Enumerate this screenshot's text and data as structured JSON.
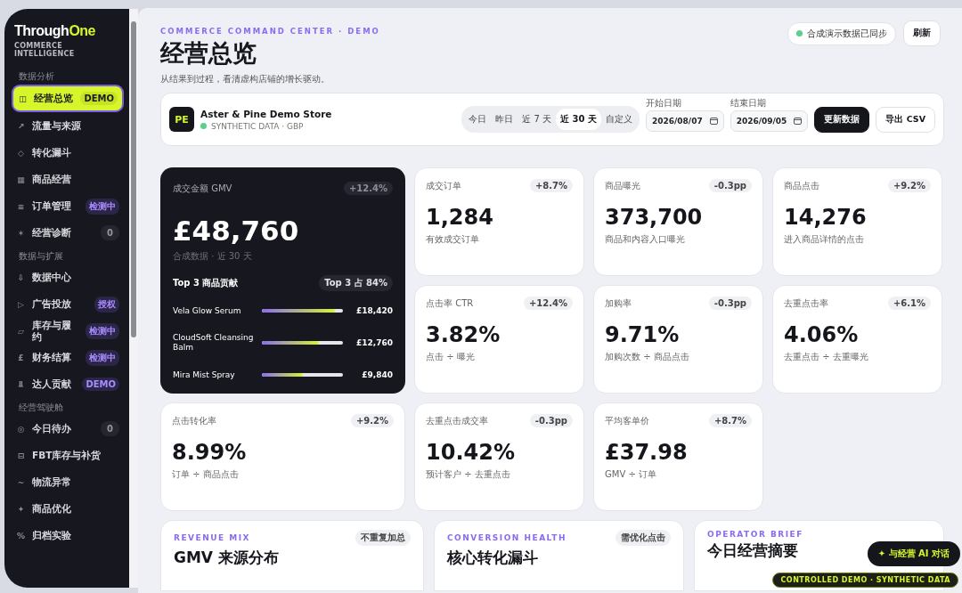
{
  "brand": {
    "name_a": "Through",
    "name_b": "One",
    "tagline": "COMMERCE INTELLIGENCE"
  },
  "sidebar": {
    "sections": [
      {
        "title": "数据分析",
        "items": [
          {
            "icon": "◫",
            "label": "经营总览",
            "badge": {
              "text": "DEMO",
              "kind": "demo"
            },
            "selected": true
          },
          {
            "icon": "↗",
            "label": "流量与来源",
            "selected": false
          },
          {
            "icon": "◇",
            "label": "转化漏斗",
            "selected": false
          },
          {
            "icon": "▦",
            "label": "商品经营",
            "selected": false
          },
          {
            "icon": "≡",
            "label": "订单管理",
            "badge": {
              "text": "检测中",
              "kind": "tag"
            },
            "selected": false
          },
          {
            "icon": "✶",
            "label": "经营诊断",
            "badge": {
              "text": "0",
              "kind": "count"
            },
            "selected": false
          }
        ]
      },
      {
        "title": "数据与扩展",
        "items": [
          {
            "icon": "⇩",
            "label": "数据中心",
            "selected": false
          },
          {
            "icon": "▷",
            "label": "广告投放",
            "badge": {
              "text": "授权",
              "kind": "tag"
            },
            "selected": false
          },
          {
            "icon": "▱",
            "label": "库存与履约",
            "badge": {
              "text": "检测中",
              "kind": "tag"
            },
            "selected": false
          },
          {
            "icon": "£",
            "label": "财务结算",
            "badge": {
              "text": "检测中",
              "kind": "tag"
            },
            "selected": false
          },
          {
            "icon": "⫫",
            "label": "达人贡献",
            "badge": {
              "text": "DEMO",
              "kind": "tag"
            },
            "selected": false
          }
        ]
      },
      {
        "title": "经营驾驶舱",
        "items": [
          {
            "icon": "◎",
            "label": "今日待办",
            "badge": {
              "text": "0",
              "kind": "count"
            },
            "selected": false
          },
          {
            "icon": "⊟",
            "label": "FBT库存与补货",
            "selected": false
          },
          {
            "icon": "~",
            "label": "物流异常",
            "selected": false
          },
          {
            "icon": "✦",
            "label": "商品优化",
            "selected": false
          },
          {
            "icon": "%",
            "label": "归档实验",
            "selected": false
          }
        ]
      }
    ]
  },
  "header": {
    "eyebrow": "COMMERCE COMMAND CENTER · DEMO",
    "title": "经营总览",
    "subtitle": "从结果到过程，看清虚构店铺的增长驱动。",
    "sync_status": "合成演示数据已同步",
    "refresh": "刷新"
  },
  "store": {
    "logo": "PE",
    "name": "Aster & Pine Demo Store",
    "meta": "SYNTHETIC DATA · GBP",
    "ranges": [
      {
        "label": "今日",
        "selected": false
      },
      {
        "label": "昨日",
        "selected": false
      },
      {
        "label": "近 7 天",
        "selected": false
      },
      {
        "label": "近 30 天",
        "selected": true
      },
      {
        "label": "自定义",
        "selected": false
      }
    ],
    "start": {
      "label": "开始日期",
      "value": "2026/08/07"
    },
    "end": {
      "label": "结束日期",
      "value": "2026/09/05"
    },
    "update": "更新数据",
    "export": "导出 CSV"
  },
  "hero": {
    "label": "成交金额 GMV",
    "delta": "+12.4%",
    "value": "£48,760",
    "note": "合成数据 · 近 30 天",
    "top_title": "Top 3 商品贡献",
    "top_share": "Top 3 占 84%",
    "products": [
      {
        "name": "Vela Glow Serum",
        "level": 0.9,
        "value": "£18,420"
      },
      {
        "name": "CloudSoft Cleansing Balm",
        "level": 0.7,
        "value": "£12,760"
      },
      {
        "name": "Mira Mist Spray",
        "level": 0.51,
        "value": "£9,840"
      }
    ]
  },
  "kpis": [
    {
      "label": "成交订单",
      "delta": "+8.7%",
      "value": "1,284",
      "note": "有效成交订单"
    },
    {
      "label": "商品曝光",
      "delta": "-0.3pp",
      "value": "373,700",
      "note": "商品和内容入口曝光"
    },
    {
      "label": "商品点击",
      "delta": "+9.2%",
      "value": "14,276",
      "note": "进入商品详情的点击"
    },
    {
      "label": "点击率 CTR",
      "delta": "+12.4%",
      "value": "3.82%",
      "note": "点击 ÷ 曝光"
    },
    {
      "label": "加购率",
      "delta": "-0.3pp",
      "value": "9.71%",
      "note": "加购次数 ÷ 商品点击"
    },
    {
      "label": "去重点击率",
      "delta": "+6.1%",
      "value": "4.06%",
      "note": "去重点击 ÷ 去重曝光"
    },
    {
      "label": "点击转化率",
      "delta": "+9.2%",
      "value": "8.99%",
      "note": "订单 ÷ 商品点击"
    },
    {
      "label": "去重点击成交率",
      "delta": "-0.3pp",
      "value": "10.42%",
      "note": "预计客户 ÷ 去重点击"
    },
    {
      "label": "平均客单价",
      "delta": "+8.7%",
      "value": "£37.98",
      "note": "GMV ÷ 订单"
    }
  ],
  "panels": [
    {
      "eyebrow": "REVENUE MIX",
      "title": "GMV 来源分布",
      "tag": "不重复加总"
    },
    {
      "eyebrow": "CONVERSION HEALTH",
      "title": "核心转化漏斗",
      "tag": "需优化点击"
    },
    {
      "eyebrow": "OPERATOR BRIEF",
      "title": "今日经营摘要"
    }
  ],
  "ai_button": "✦ 与经营 AI 对话",
  "demo_badge": "CONTROLLED DEMO · SYNTHETIC DATA"
}
